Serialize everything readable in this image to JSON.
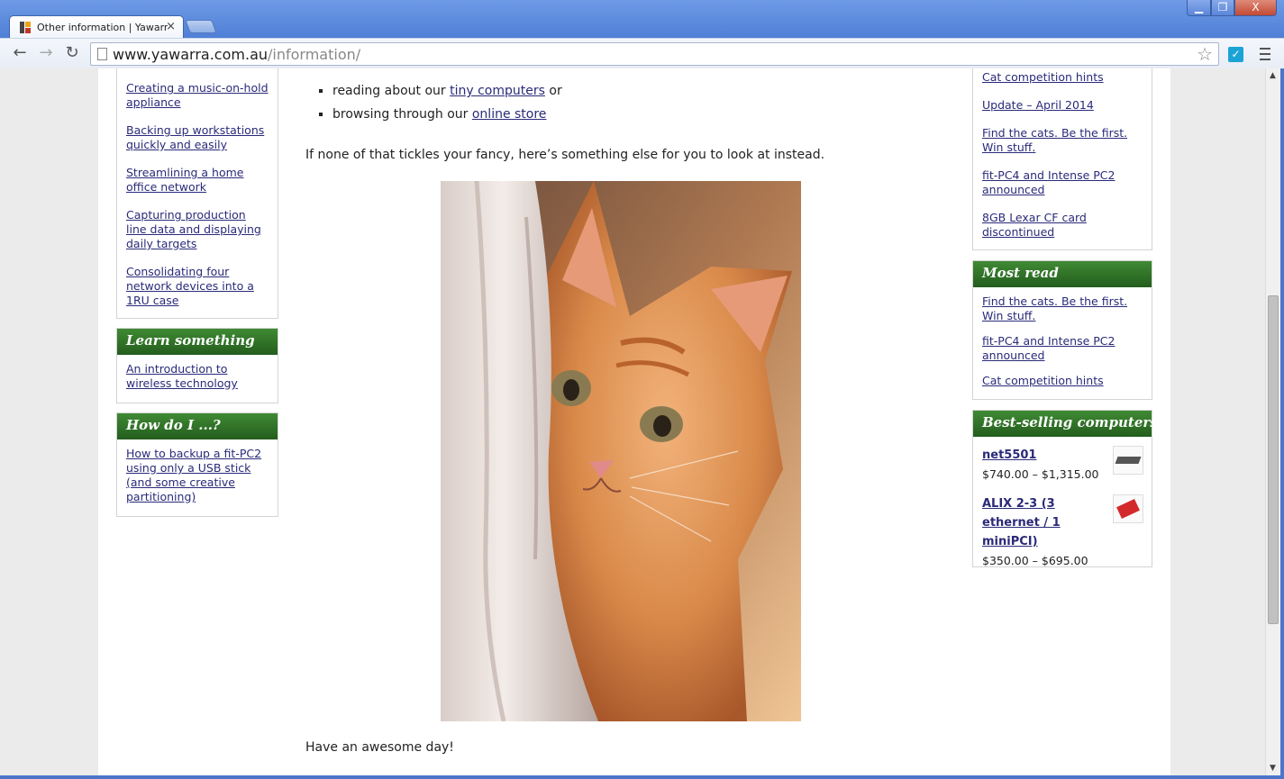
{
  "browser": {
    "tab_title": "Other information | Yawarra",
    "tab_close": "×",
    "url_host": "www.yawarra.com.au",
    "url_path": "/information/",
    "window_buttons": {
      "minimize": "▁",
      "maximize": "❐",
      "close": "X"
    },
    "back": "←",
    "forward": "→",
    "reload": "↻",
    "star": "☆",
    "ext_icon": "✓"
  },
  "left_sidebar": {
    "top_links": [
      "Creating a music-on-hold appliance",
      "Backing up workstations quickly and easily",
      "Streamlining a home office network",
      "Capturing production line data and displaying daily targets",
      "Consolidating four network devices into a 1RU case"
    ],
    "learn": {
      "title": "Learn something",
      "links": [
        "An introduction to wireless technology"
      ]
    },
    "howdoi": {
      "title": "How do I ...?",
      "links": [
        "How to backup a fit-PC2 using only a USB stick (and some creative partitioning)"
      ]
    }
  },
  "main": {
    "bullet1_prefix": "reading about our ",
    "bullet1_link": "tiny computers",
    "bullet1_suffix": " or",
    "bullet2_prefix": "browsing through our ",
    "bullet2_link": "online store",
    "fancy_text": "If none of that tickles your fancy, here’s something else for you to look at instead.",
    "closing_text": "Have an awesome day!"
  },
  "right_sidebar": {
    "recent_links": [
      "Cat competition hints",
      "Update – April 2014",
      "Find the cats. Be the first. Win stuff.",
      "fit-PC4 and Intense PC2 announced",
      "8GB Lexar CF card discontinued"
    ],
    "most_read": {
      "title": "Most read",
      "links": [
        "Find the cats. Be the first. Win stuff.",
        "fit-PC4 and Intense PC2 announced",
        "Cat competition hints"
      ]
    },
    "best_selling": {
      "title": "Best-selling computers",
      "products": [
        {
          "name": "net5501",
          "price": "$740.00 – $1,315.00",
          "thumb_color": "#555555"
        },
        {
          "name": "ALIX 2-3 (3 ethernet / 1 miniPCI)",
          "price": "$350.00 – $695.00",
          "thumb_color": "#d22a2a"
        }
      ]
    }
  },
  "colors": {
    "widget_header": "#2f7228",
    "link": "#2a2a7a",
    "chrome_frame": "#4a76c9"
  }
}
